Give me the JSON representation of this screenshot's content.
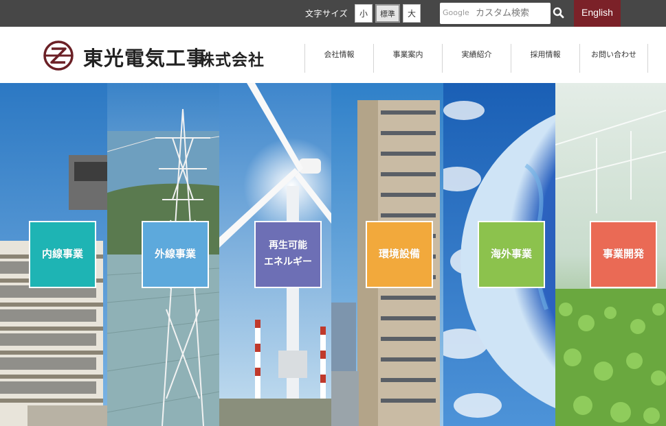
{
  "topbar": {
    "font_size_label": "文字サイズ",
    "font_sizes": [
      "小",
      "標準",
      "大"
    ],
    "active_font_size": "標準",
    "search_brand": "Google",
    "search_placeholder": "カスタム検索",
    "search_icon": "search-icon",
    "english_label": "English",
    "colors": {
      "bar": "#474747",
      "english": "#7b2128"
    }
  },
  "header": {
    "logo_name": "東光電気工事",
    "logo_suffix": "株式会社",
    "logo_icon": "company-logo-mark",
    "logo_color": "#6b2026",
    "nav": [
      "会社情報",
      "事業案内",
      "実績紹介",
      "採用情報",
      "お問い合わせ"
    ]
  },
  "hero": {
    "panels": [
      {
        "label_lines": [
          "内線事業"
        ],
        "color": "#1eb4b4",
        "scene": "office-building"
      },
      {
        "label_lines": [
          "外線事業"
        ],
        "color": "#5da9dc",
        "scene": "power-tower"
      },
      {
        "label_lines": [
          "再生可能",
          "エネルギー"
        ],
        "color": "#6d6fb5",
        "scene": "wind-turbine"
      },
      {
        "label_lines": [
          "環境設備"
        ],
        "color": "#f2a93c",
        "scene": "skyscraper"
      },
      {
        "label_lines": [
          "海外事業"
        ],
        "color": "#8cc24d",
        "scene": "globe"
      },
      {
        "label_lines": [
          "事業開発"
        ],
        "color": "#ea6a55",
        "scene": "greenhouse"
      }
    ]
  }
}
